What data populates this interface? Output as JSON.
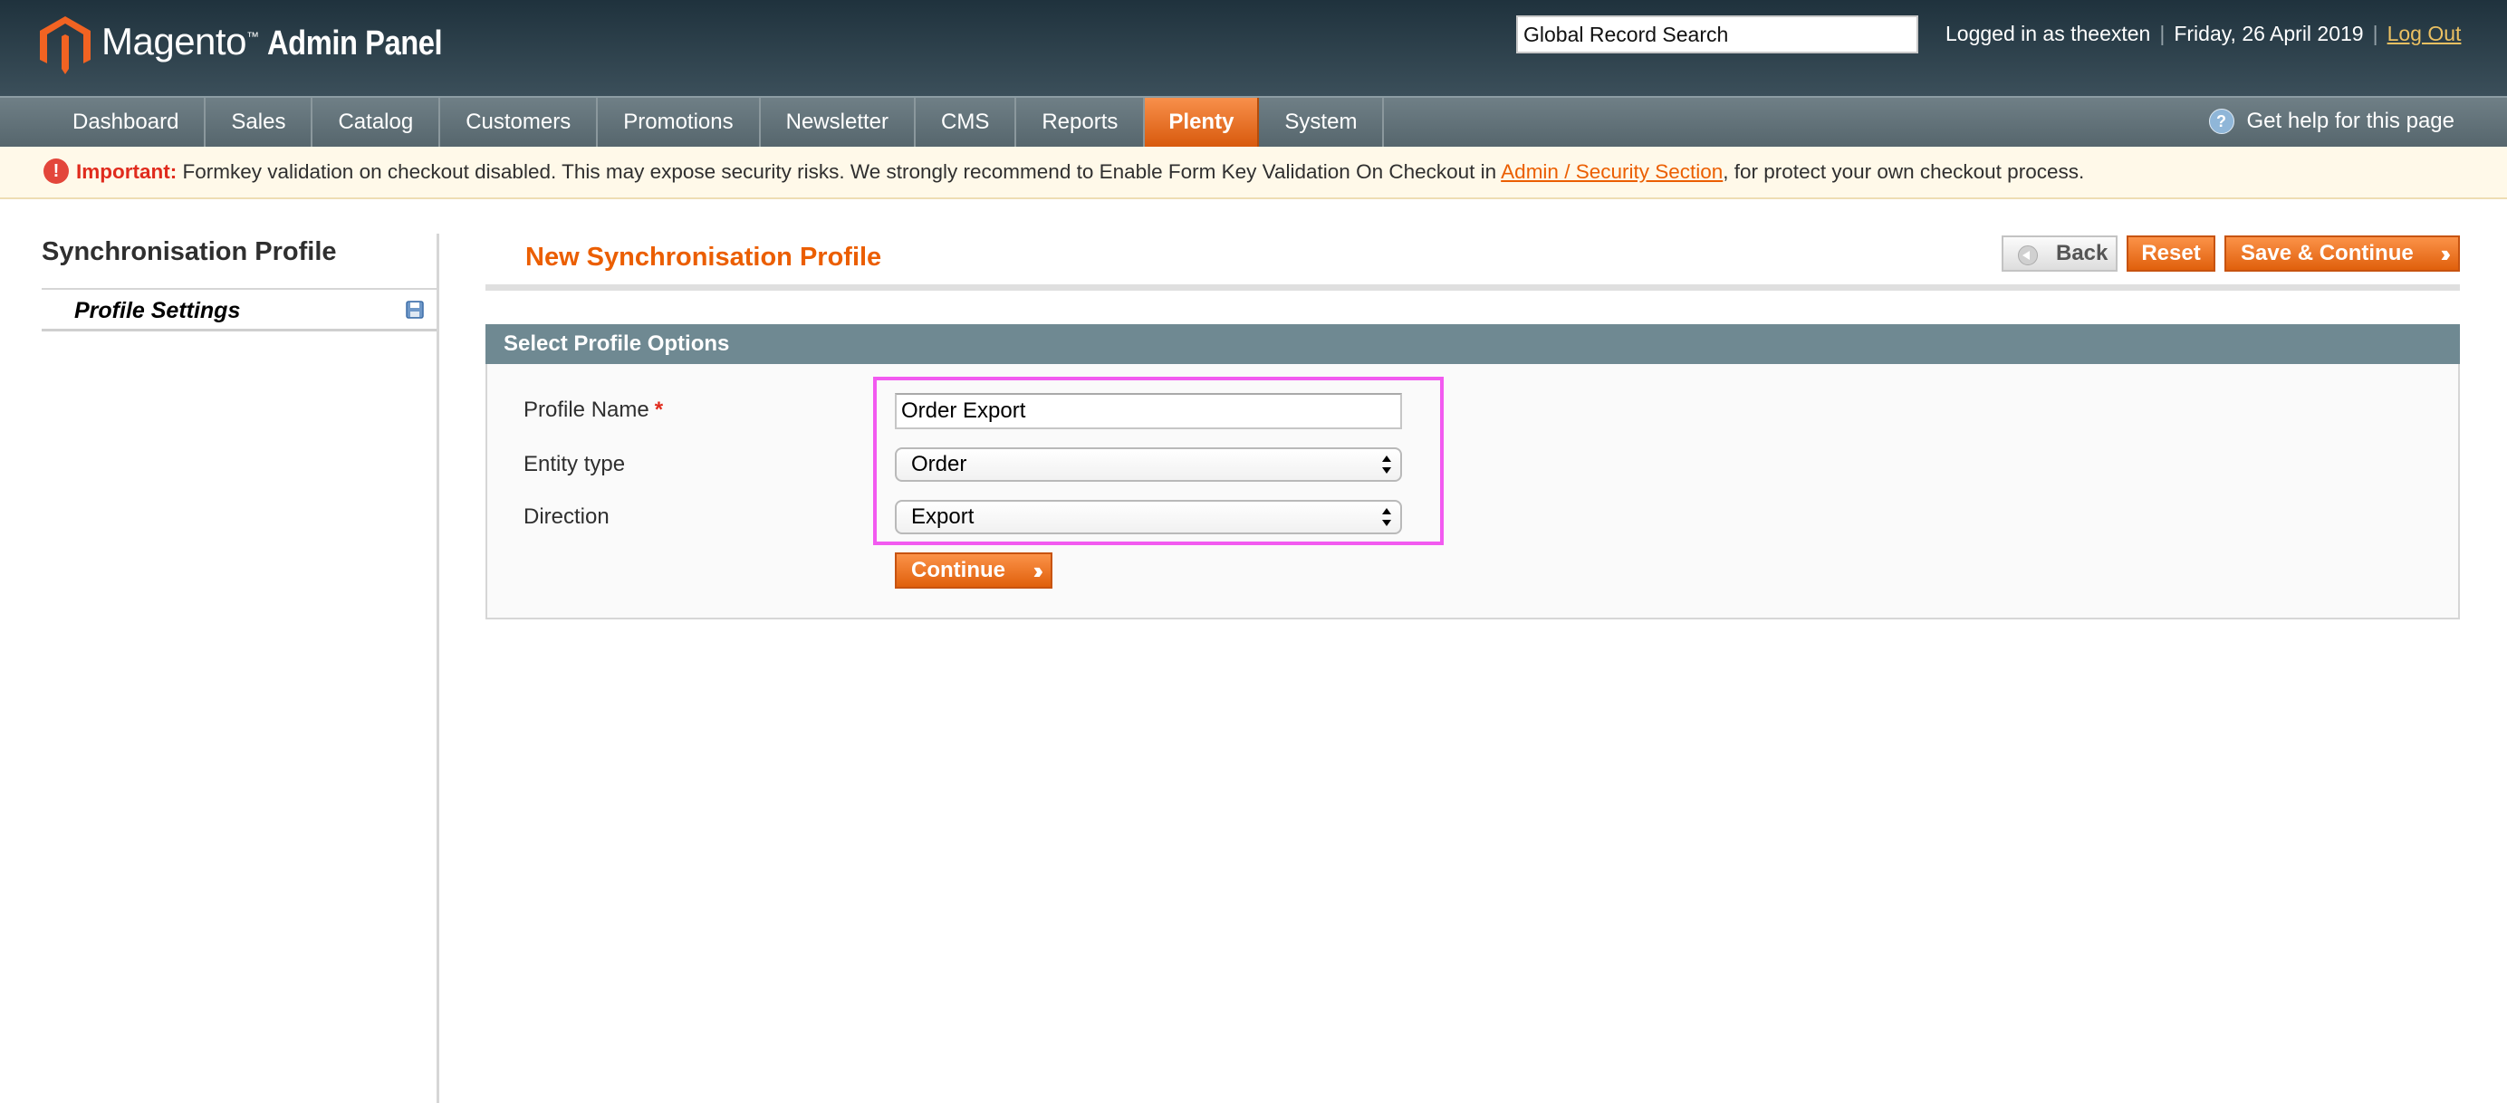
{
  "header": {
    "brand": "Magento",
    "brand_tm": "™",
    "brand_sub": "Admin Panel",
    "search_placeholder": "Global Record Search",
    "logged_in": "Logged in as theexten",
    "date": "Friday, 26 April 2019",
    "logout": "Log Out"
  },
  "nav": {
    "items": [
      "Dashboard",
      "Sales",
      "Catalog",
      "Customers",
      "Promotions",
      "Newsletter",
      "CMS",
      "Reports",
      "Plenty",
      "System"
    ],
    "active": "Plenty",
    "help": "Get help for this page"
  },
  "notice": {
    "important": "Important:",
    "text_before": " Formkey validation on checkout disabled. This may expose security risks. We strongly recommend to Enable Form Key Validation On Checkout in ",
    "link": "Admin / Security Section",
    "text_after": ", for protect your own checkout process."
  },
  "sidebar": {
    "title": "Synchronisation Profile",
    "items": [
      {
        "label": "Profile Settings"
      }
    ]
  },
  "main": {
    "title": "New Synchronisation Profile",
    "buttons": {
      "back": "Back",
      "reset": "Reset",
      "save_continue": "Save & Continue"
    },
    "fieldset_title": "Select Profile Options",
    "fields": {
      "profile_name": {
        "label": "Profile Name",
        "required": "*",
        "value": "Order Export"
      },
      "entity_type": {
        "label": "Entity type",
        "value": "Order"
      },
      "direction": {
        "label": "Direction",
        "value": "Export"
      }
    },
    "continue": "Continue"
  },
  "colors": {
    "accent_orange": "#eb5e00",
    "header_dark": "#1f323d",
    "nav_gray": "#627278",
    "fieldset_head": "#6f8992",
    "highlight_magenta": "#f25af0"
  },
  "icons": [
    "magento-logo-icon",
    "help-icon",
    "error-icon",
    "save-icon",
    "back-arrow-icon",
    "double-chevron-right-icon",
    "select-arrows-icon"
  ]
}
